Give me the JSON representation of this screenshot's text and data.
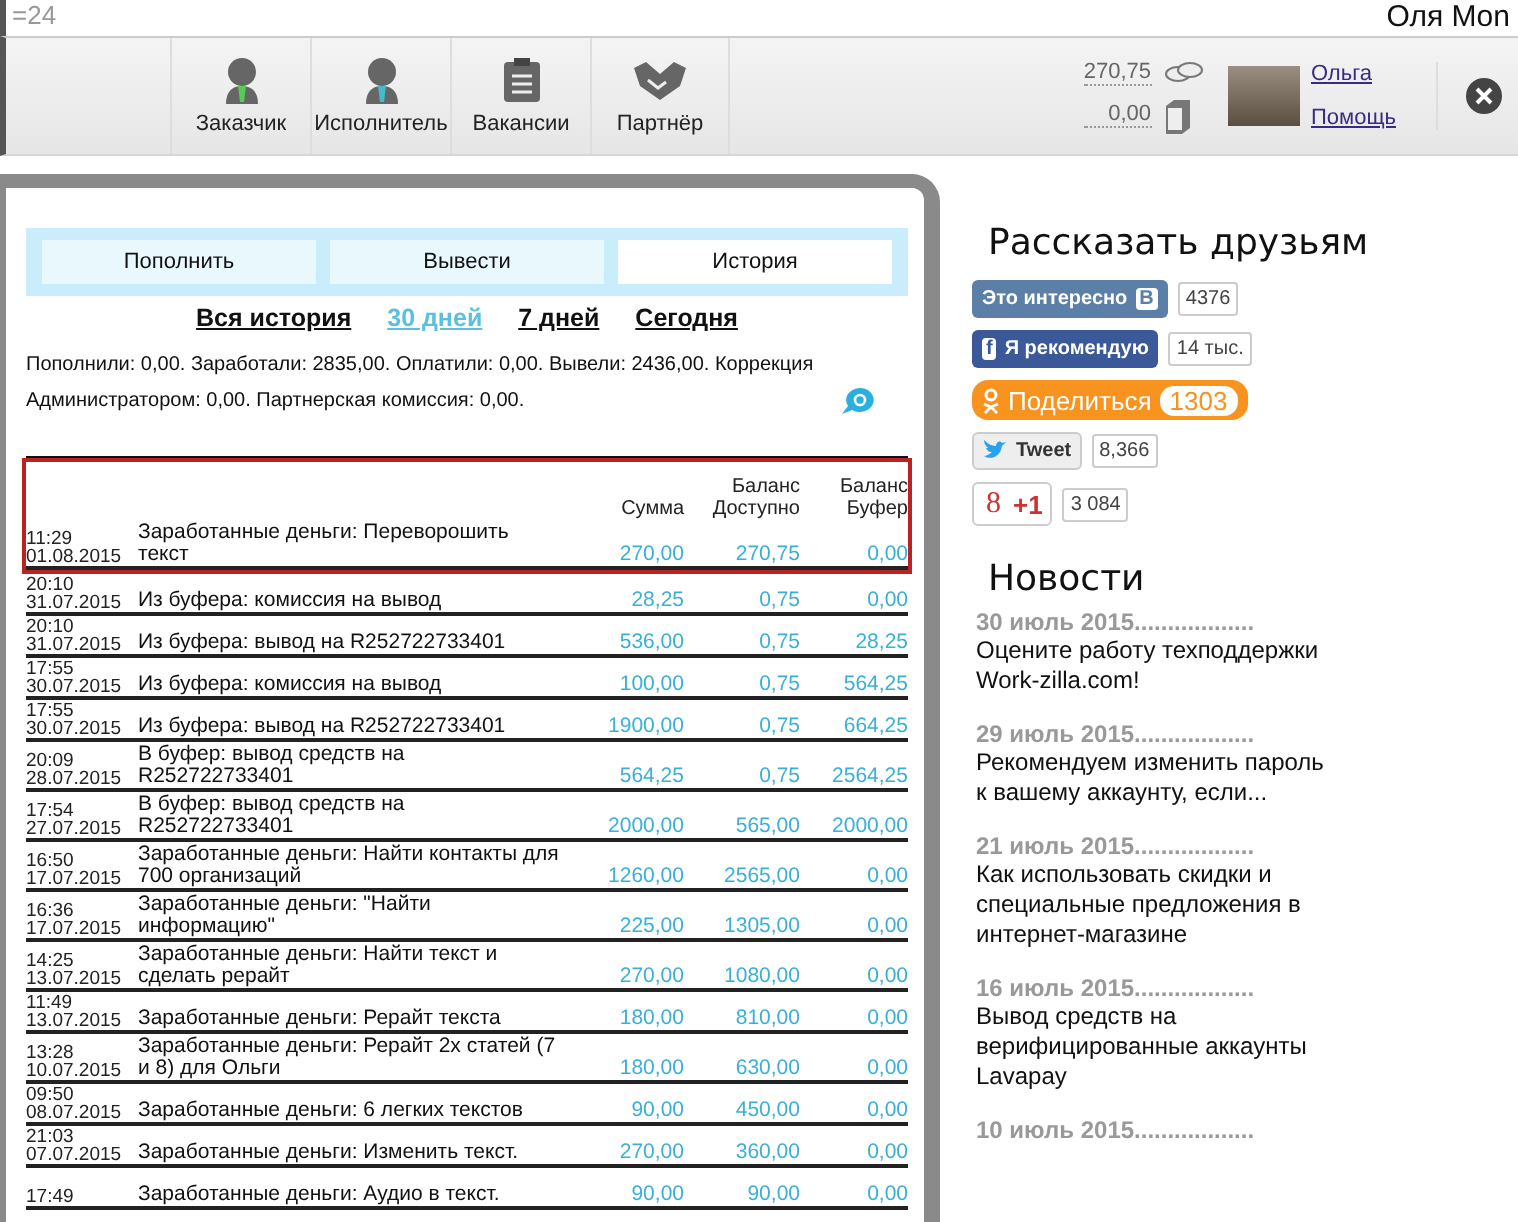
{
  "top_strip": {
    "left": "=24",
    "right": "Оля Mon"
  },
  "nav": [
    {
      "kind": "client",
      "label": "Заказчик"
    },
    {
      "kind": "freelancer",
      "label": "Исполнитель"
    },
    {
      "kind": "vacancies",
      "label": "Вакансии"
    },
    {
      "kind": "partner",
      "label": "Партнёр"
    }
  ],
  "account": {
    "balance": "270,75",
    "buffer": "0,00",
    "user": "Ольга",
    "help": "Помощь"
  },
  "tabs": [
    {
      "label": "Пополнить",
      "selected": false
    },
    {
      "label": "Вывести",
      "selected": false
    },
    {
      "label": "История",
      "selected": true
    }
  ],
  "periods": [
    {
      "label": "Вся история",
      "selected": false
    },
    {
      "label": "30 дней",
      "selected": true
    },
    {
      "label": "7 дней",
      "selected": false
    },
    {
      "label": "Сегодня",
      "selected": false
    }
  ],
  "summary": "Пополнили: 0,00. Заработали: 2835,00. Оплатили: 0,00. Вывели: 2436,00. Коррекция Администратором: 0,00. Партнерская комиссия: 0,00.",
  "table": {
    "columns": [
      "Сумма",
      "Баланс Доступно",
      "Баланс Буфер"
    ],
    "rows": [
      {
        "time": "11:29",
        "date": "01.08.2015",
        "description": "Заработанные деньги: Переворошить текст",
        "amount": "270,00",
        "available": "270,75",
        "buffer": "0,00",
        "marked": true
      },
      {
        "time": "20:10",
        "date": "31.07.2015",
        "description": "Из буфера: комиссия на вывод",
        "amount": "28,25",
        "available": "0,75",
        "buffer": "0,00",
        "marked": false
      },
      {
        "time": "20:10",
        "date": "31.07.2015",
        "description": "Из буфера: вывод на R252722733401",
        "amount": "536,00",
        "available": "0,75",
        "buffer": "28,25",
        "marked": false
      },
      {
        "time": "17:55",
        "date": "30.07.2015",
        "description": "Из буфера: комиссия на вывод",
        "amount": "100,00",
        "available": "0,75",
        "buffer": "564,25",
        "marked": false
      },
      {
        "time": "17:55",
        "date": "30.07.2015",
        "description": "Из буфера: вывод на R252722733401",
        "amount": "1900,00",
        "available": "0,75",
        "buffer": "664,25",
        "marked": false
      },
      {
        "time": "20:09",
        "date": "28.07.2015",
        "description": "В буфер: вывод средств на R252722733401",
        "amount": "564,25",
        "available": "0,75",
        "buffer": "2564,25",
        "marked": false
      },
      {
        "time": "17:54",
        "date": "27.07.2015",
        "description": "В буфер: вывод средств на R252722733401",
        "amount": "2000,00",
        "available": "565,00",
        "buffer": "2000,00",
        "marked": false
      },
      {
        "time": "16:50",
        "date": "17.07.2015",
        "description": "Заработанные деньги: Найти контакты для 700 организаций",
        "amount": "1260,00",
        "available": "2565,00",
        "buffer": "0,00",
        "marked": false
      },
      {
        "time": "16:36",
        "date": "17.07.2015",
        "description": "Заработанные деньги: \"Найти информацию\"",
        "amount": "225,00",
        "available": "1305,00",
        "buffer": "0,00",
        "marked": false
      },
      {
        "time": "14:25",
        "date": "13.07.2015",
        "description": "Заработанные деньги: Найти текст и сделать рерайт",
        "amount": "270,00",
        "available": "1080,00",
        "buffer": "0,00",
        "marked": false
      },
      {
        "time": "11:49",
        "date": "13.07.2015",
        "description": "Заработанные деньги: Рерайт текста",
        "amount": "180,00",
        "available": "810,00",
        "buffer": "0,00",
        "marked": false
      },
      {
        "time": "13:28",
        "date": "10.07.2015",
        "description": "Заработанные деньги: Рерайт 2х статей (7 и 8) для Ольги",
        "amount": "180,00",
        "available": "630,00",
        "buffer": "0,00",
        "marked": false
      },
      {
        "time": "09:50",
        "date": "08.07.2015",
        "description": "Заработанные деньги: 6 легких текстов",
        "amount": "90,00",
        "available": "450,00",
        "buffer": "0,00",
        "marked": false
      },
      {
        "time": "21:03",
        "date": "07.07.2015",
        "description": "Заработанные деньги: Изменить текст.",
        "amount": "270,00",
        "available": "360,00",
        "buffer": "0,00",
        "marked": false
      },
      {
        "time": "17:49",
        "description": "Заработанные деньги: Аудио в текст.",
        "amount": "90,00",
        "available": "90,00",
        "buffer": "0,00",
        "marked": false
      }
    ]
  },
  "sidebar": {
    "share_title": "Рассказать друзьям",
    "share": [
      {
        "kind": "vk",
        "label": "Это интересно",
        "logo": "B",
        "count": "4376"
      },
      {
        "kind": "fb",
        "label": "Я рекомендую",
        "logo": "f",
        "count": "14 тыс."
      },
      {
        "kind": "ok",
        "label": "Поделиться",
        "count": "1303"
      },
      {
        "kind": "tw",
        "label": "Tweet",
        "count": "8,366"
      },
      {
        "kind": "gp",
        "label": "+1",
        "logo": "8",
        "count": "3 084"
      }
    ],
    "news_title": "Новости",
    "news": [
      {
        "date": "30 июль 2015..................",
        "title": "Оцените работу техподдержки Work-zilla.com!"
      },
      {
        "date": "29 июль 2015..................",
        "title": "Рекомендуем изменить пароль к вашему аккаунту, если..."
      },
      {
        "date": "21 июль 2015..................",
        "title": "Как использовать скидки и специальные предложения в интернет-магазине"
      },
      {
        "date": "16 июль 2015..................",
        "title": "Вывод средств на верифицированные аккаунты Lavapay"
      },
      {
        "date": "10 июль 2015.................."
      }
    ]
  }
}
